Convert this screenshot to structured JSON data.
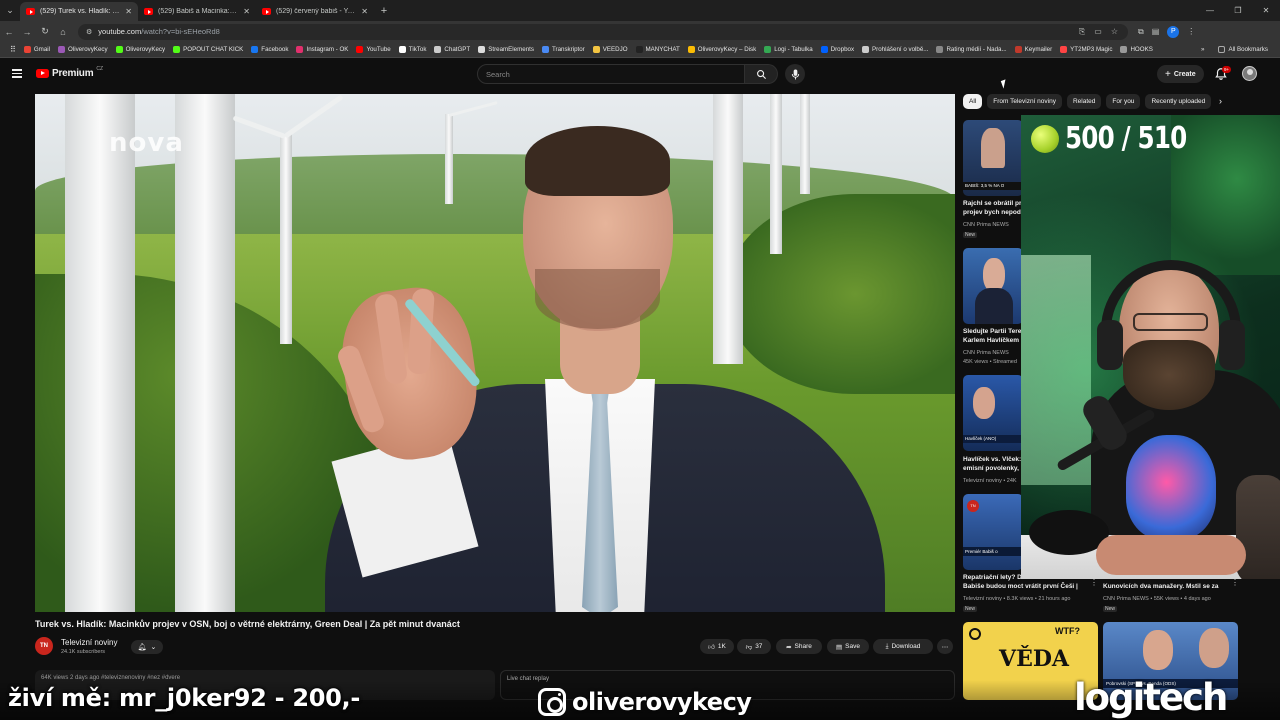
{
  "browser": {
    "tabs": [
      {
        "label": "(529) Turek vs. Hladík: Macinků"
      },
      {
        "label": "(529) Babiš a Macinka: Opatřen"
      },
      {
        "label": "(529) červený babiš - YouTube"
      }
    ],
    "url_host": "youtube.com",
    "url_path": "/watch?v=bi-sEHeoRd8"
  },
  "bookmarks": [
    {
      "label": "Gmail",
      "color": "#ea4335"
    },
    {
      "label": "OliverovyKecy",
      "color": "#9b59b6"
    },
    {
      "label": "OliverovyKecy",
      "color": "#53fc18"
    },
    {
      "label": "POPOUT CHAT KICK",
      "color": "#53fc18"
    },
    {
      "label": "Facebook",
      "color": "#1877f2"
    },
    {
      "label": "Instagram - OK",
      "color": "#e1306c"
    },
    {
      "label": "YouTube",
      "color": "#ff0000"
    },
    {
      "label": "TikTok",
      "color": "#ffffff"
    },
    {
      "label": "ChatGPT",
      "color": "#cccccc"
    },
    {
      "label": "StreamElements",
      "color": "#dddddd"
    },
    {
      "label": "Transkriptor",
      "color": "#4a8af4"
    },
    {
      "label": "VEEDJO",
      "color": "#f4c542"
    },
    {
      "label": "MANYCHAT",
      "color": "#222222"
    },
    {
      "label": "OliverovyKecy – Disk",
      "color": "#fbbc04"
    },
    {
      "label": "Logi - Tabulka",
      "color": "#34a853"
    },
    {
      "label": "Dropbox",
      "color": "#0061ff"
    },
    {
      "label": "Prohlášení o volbě...",
      "color": "#cccccc"
    },
    {
      "label": "Rating médií - Nada...",
      "color": "#888888"
    },
    {
      "label": "Keymailer",
      "color": "#c0392b"
    },
    {
      "label": "YT2MP3 Magic",
      "color": "#ff4444"
    },
    {
      "label": "HOOKS",
      "color": "#999999"
    }
  ],
  "all_bookmarks_label": "All Bookmarks",
  "youtube": {
    "brand": "Premium",
    "region": "CZ",
    "search_placeholder": "Search",
    "create_label": "Create",
    "notif_count": "9+"
  },
  "video": {
    "watermark": "nova",
    "title": "Turek vs. Hladík: Macinkův projev v OSN, boj o větrné elektrárny, Green Deal | Za pět minut dvanáct",
    "channel_initials": "TN",
    "channel_name": "Televizní noviny",
    "channel_subs": "24.1K subscribers",
    "likes": "1K",
    "dislikes": "37",
    "share_label": "Share",
    "save_label": "Save",
    "download_label": "Download",
    "desc_line": "64K views  2 days ago  #televiznenoviny #nez #dvere",
    "chat_replay": "Live chat replay"
  },
  "chips": [
    "All",
    "From Televizní noviny",
    "Related",
    "For you",
    "Recently uploaded"
  ],
  "related": [
    {
      "thumb_tag": "BABIŠ: 3,5 % NA O",
      "title1": "Rajchl se obrátil pr",
      "title2": "projev bych nepodě",
      "meta": "CNN Prima NEWS",
      "badge": "New"
    },
    {
      "thumb_tag": "",
      "title1": "Sledujte Partii Terez",
      "title2": "Karlem Havlíčkem",
      "meta": "CNN Prima NEWS",
      "meta2": "45K views • Streamed",
      "badge": ""
    },
    {
      "thumb_tag": "Havlíček (ANO)",
      "title1": "Havlíček vs. Vlček:",
      "title2": "emisní povolenky,",
      "meta": "Televizní noviny • 24K",
      "badge": ""
    },
    {
      "thumb_tag": "Premiér Babiš o",
      "title1": "Repatriační lety? Do",
      "title2": "Babiše budou moct vrátit první Češi |",
      "meta": "Televizní noviny • 8.3K views • 21 hours ago",
      "badge": "New"
    }
  ],
  "related_right": {
    "title": "Kunovicích dva manažery. Mstil se za",
    "meta": "CNN Prima NEWS • 55K views • 4 days ago",
    "badge": "New"
  },
  "bottom_cards": [
    {
      "text": "VĚDA",
      "tag": "WTF?"
    },
    {
      "text": "Pobrovski (SPD) vs. Benda (ODS)",
      "tag": ""
    }
  ],
  "stream_overlay": {
    "score": "500 / 510",
    "live_text": "živí mě: mr_j0ker92 - 200,-",
    "instagram": "oliverovykecy",
    "sponsor": "logitech"
  }
}
